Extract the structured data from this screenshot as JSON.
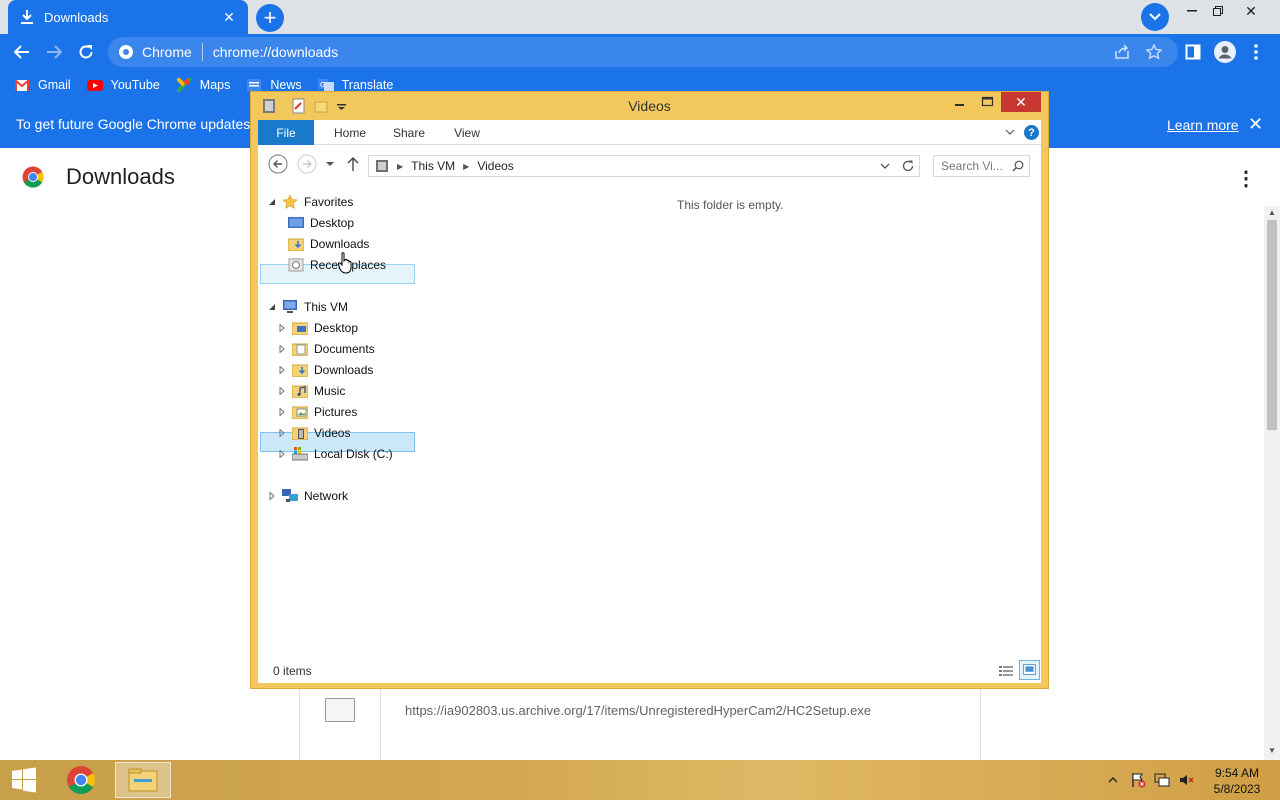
{
  "browser": {
    "tab": {
      "title": "Downloads"
    },
    "omnibox": {
      "site": "Chrome",
      "url": "chrome://downloads"
    },
    "bookmarks": [
      {
        "label": "Gmail"
      },
      {
        "label": "YouTube"
      },
      {
        "label": "Maps"
      },
      {
        "label": "News"
      },
      {
        "label": "Translate"
      }
    ],
    "infobar": {
      "text": "To get future Google Chrome updates, yo",
      "link": "Learn more"
    },
    "page_title": "Downloads",
    "download": {
      "url": "https://ia902803.us.archive.org/17/items/UnregisteredHyperCam2/HC2Setup.exe"
    },
    "accent": "#1a73e8"
  },
  "explorer": {
    "title": "Videos",
    "ribbon_tabs": [
      "File",
      "Home",
      "Share",
      "View"
    ],
    "address": [
      "This VM",
      "Videos"
    ],
    "search_placeholder": "Search Vi...",
    "favorites": {
      "label": "Favorites",
      "items": [
        "Desktop",
        "Downloads",
        "Recent places"
      ]
    },
    "this_pc": {
      "label": "This VM",
      "items": [
        "Desktop",
        "Documents",
        "Downloads",
        "Music",
        "Pictures",
        "Videos",
        "Local Disk (C:)"
      ]
    },
    "network": {
      "label": "Network"
    },
    "empty_message": "This folder is empty.",
    "status": "0 items",
    "frame_color": "#f2c75c"
  },
  "taskbar": {
    "time": "9:54 AM",
    "date": "5/8/2023"
  }
}
